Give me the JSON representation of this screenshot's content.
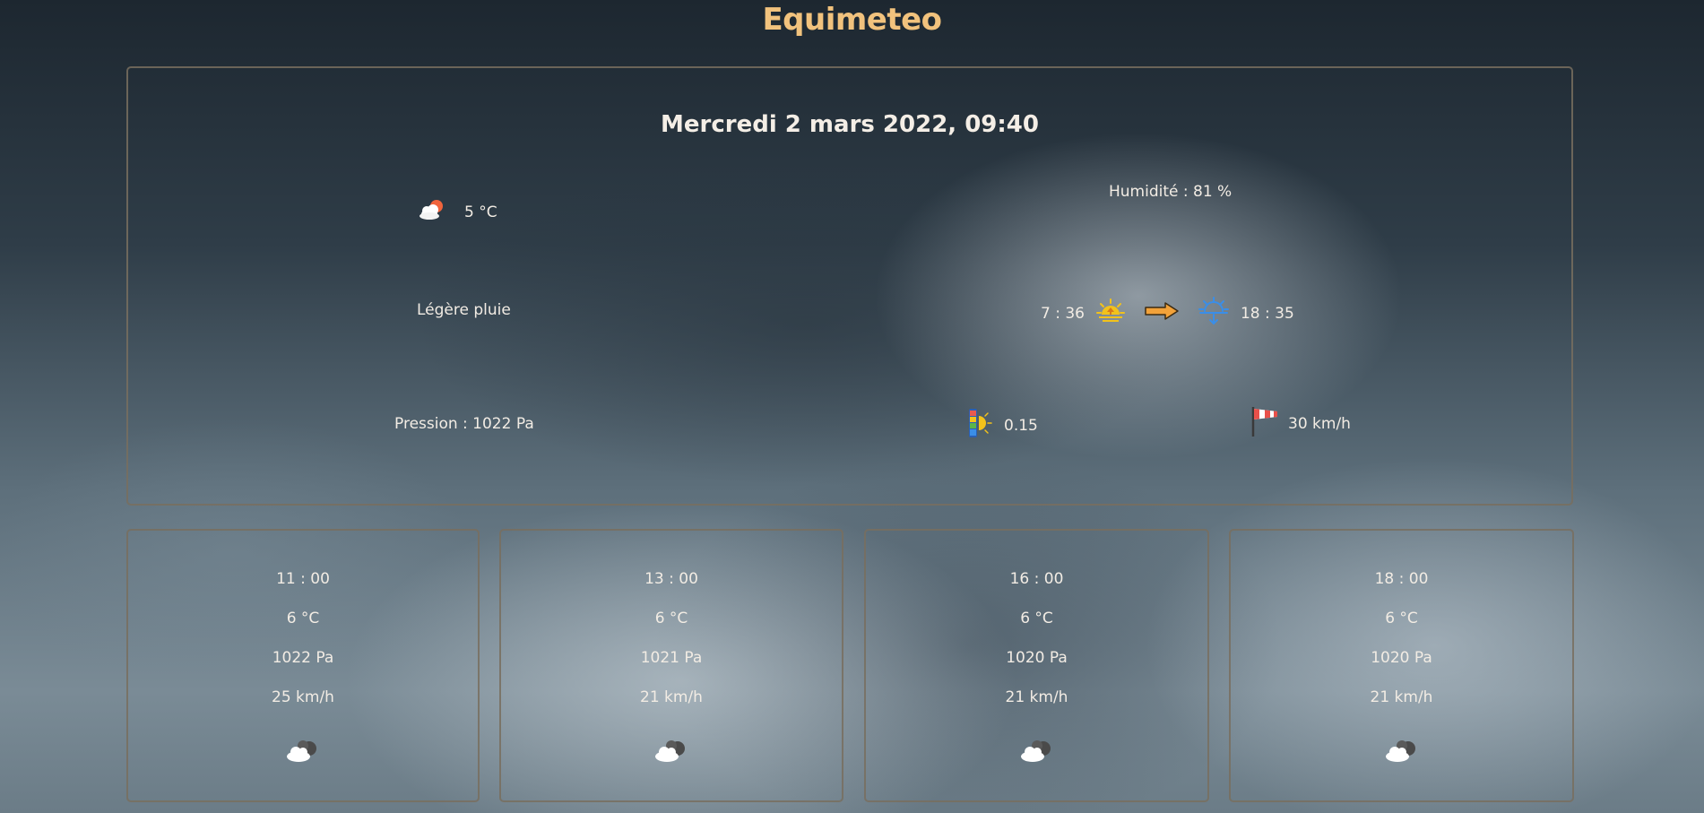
{
  "app": {
    "title": "Equimeteo"
  },
  "current": {
    "datetime": "Mercredi 2 mars 2022, 09:40",
    "weather_icon": "cloud-sun-icon",
    "temperature": "5 °C",
    "description": "Légère pluie",
    "humidity": "Humidité : 81 %",
    "sunrise": "7 : 36",
    "sunset": "18 : 35",
    "pressure": "Pression : 1022 Pa",
    "uv_index": "0.15",
    "wind": "30 km/h"
  },
  "forecast": [
    {
      "time": "11 : 00",
      "temperature": "6 °C",
      "pressure": "1022 Pa",
      "wind": "25 km/h",
      "icon": "cloudy-icon"
    },
    {
      "time": "13 : 00",
      "temperature": "6 °C",
      "pressure": "1021 Pa",
      "wind": "21 km/h",
      "icon": "cloudy-icon"
    },
    {
      "time": "16 : 00",
      "temperature": "6 °C",
      "pressure": "1020 Pa",
      "wind": "21 km/h",
      "icon": "cloudy-icon"
    },
    {
      "time": "18 : 00",
      "temperature": "6 °C",
      "pressure": "1020 Pa",
      "wind": "21 km/h",
      "icon": "cloudy-icon"
    }
  ],
  "colors": {
    "title": "#f1c27d",
    "text": "#f2ece4",
    "border": "#786e5f"
  }
}
